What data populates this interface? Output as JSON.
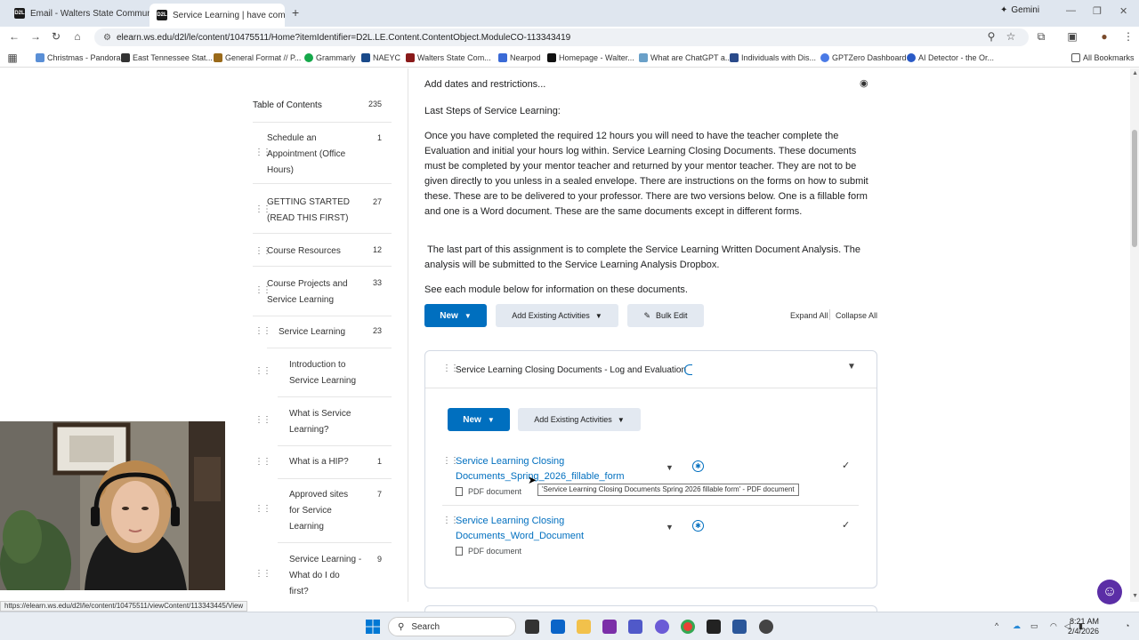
{
  "browser": {
    "tabs": [
      {
        "title": "Email - Walters State Communi"
      },
      {
        "title": "Service Learning | have comple"
      }
    ],
    "gemini_label": "Gemini",
    "url": "elearn.ws.edu/d2l/le/content/10475511/Home?itemIdentifier=D2L.LE.Content.ContentObject.ModuleCO-113343419",
    "bookmarks": [
      "Christmas - Pandora",
      "East Tennessee Stat...",
      "General Format // P...",
      "Grammarly",
      "NAEYC",
      "Walters State Com...",
      "Nearpod",
      "Homepage - Walter...",
      "What are ChatGPT a...",
      "Individuals with Dis...",
      "GPTZero Dashboard",
      "AI Detector - the Or..."
    ],
    "all_bookmarks": "All Bookmarks"
  },
  "toc": {
    "header": "Table of Contents",
    "header_count": "235",
    "items": [
      {
        "label_lines": [
          "Schedule an",
          "Appointment (Office",
          "Hours)"
        ],
        "count": "1"
      },
      {
        "label_lines": [
          "GETTING STARTED",
          "(READ THIS FIRST)"
        ],
        "count": "27"
      },
      {
        "label_lines": [
          "Course Resources"
        ],
        "count": "12"
      },
      {
        "label_lines": [
          "Course Projects and",
          "Service Learning"
        ],
        "count": "33"
      },
      {
        "label_lines": [
          "Service Learning"
        ],
        "count": "23"
      },
      {
        "label_lines": [
          "Introduction to",
          "Service Learning"
        ],
        "count": ""
      },
      {
        "label_lines": [
          "What is Service",
          "Learning?"
        ],
        "count": ""
      },
      {
        "label_lines": [
          "What is a HIP?"
        ],
        "count": "1"
      },
      {
        "label_lines": [
          "Approved sites",
          "for Service",
          "Learning"
        ],
        "count": "7"
      },
      {
        "label_lines": [
          "Service Learning -",
          "What do I do",
          "first?"
        ],
        "count": "9"
      }
    ]
  },
  "content": {
    "add_dates": "Add dates and restrictions...",
    "last_steps": "Last Steps of Service Learning:",
    "para1": "Once you have completed the required 12 hours you will need to have the teacher complete the Evaluation and initial your hours log within. Service Learning Closing Documents. These documents must be completed by your mentor teacher and returned by your mentor teacher. They are not to be given directly to you unless in a sealed envelope. There are instructions on the forms on how to submit these. These are to be delivered to your professor. There are two versions below. One is a fillable form and one is a Word document. These are the same documents except in different forms.",
    "para2": " The last part of this assignment is to complete the Service Learning Written Document Analysis. The analysis will be submitted to the Service Learning Analysis Dropbox.",
    "para3": "See each module below for information on these documents.",
    "new_label": "New",
    "add_existing": "Add Existing Activities",
    "bulk_edit": "Bulk Edit",
    "expand_all": "Expand All",
    "collapse_all": "Collapse All"
  },
  "module": {
    "title": "Service Learning Closing Documents - Log and Evaluation",
    "new_label": "New",
    "add_existing": "Add Existing Activities",
    "items": [
      {
        "title_lines": [
          "Service Learning Closing",
          "Documents_Spring_2026_fillable_form"
        ],
        "type": "PDF document"
      },
      {
        "title_lines": [
          "Service Learning Closing",
          "Documents_Word_Document"
        ],
        "type": "PDF document"
      }
    ],
    "tooltip": "'Service Learning Closing Documents Spring 2026 fillable form' - PDF document"
  },
  "status_url": "https://elearn.ws.edu/d2l/le/content/10475511/viewContent/113343445/View",
  "taskbar": {
    "search_placeholder": "Search",
    "time": "8:21 AM",
    "date": "2/4/2026"
  },
  "colors": {
    "accent": "#006fbf",
    "secondary": "#e3e9f1"
  }
}
